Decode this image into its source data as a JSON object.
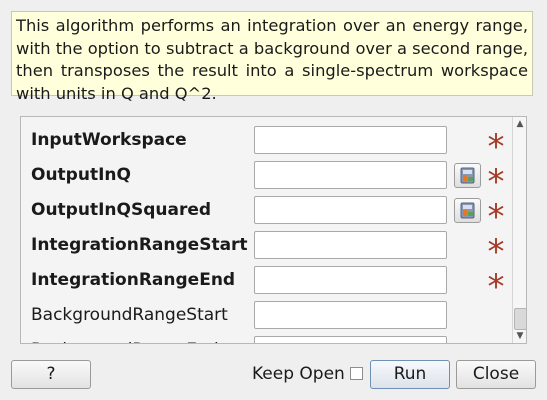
{
  "description": "This algorithm performs an integration over an energy range, with the option to subtract a background over a second range, then transposes the result into a single-spectrum workspace with units in Q and Q^2.",
  "properties": [
    {
      "label": "InputWorkspace",
      "value": "",
      "required": true,
      "browse": false
    },
    {
      "label": "OutputInQ",
      "value": "",
      "required": true,
      "browse": true
    },
    {
      "label": "OutputInQSquared",
      "value": "",
      "required": true,
      "browse": true
    },
    {
      "label": "IntegrationRangeStart",
      "value": "",
      "required": true,
      "browse": false
    },
    {
      "label": "IntegrationRangeEnd",
      "value": "",
      "required": true,
      "browse": false
    },
    {
      "label": "BackgroundRangeStart",
      "value": "",
      "required": false,
      "browse": false
    },
    {
      "label": "BackgroundRangeEnd",
      "value": "",
      "required": false,
      "browse": false
    }
  ],
  "required_marker": "*",
  "buttons": {
    "help_label": "?",
    "keep_open_label": "Keep Open",
    "keep_open_checked": false,
    "run_label": "Run",
    "close_label": "Close"
  },
  "icons": {
    "browse": "workspace-browse-icon",
    "scroll_up": "scroll-up-arrow-icon",
    "scroll_down": "scroll-down-arrow-icon"
  },
  "colors": {
    "description_bg": "#ffffdc",
    "required_star": "#a33b2a",
    "dialog_bg": "#efefef"
  }
}
